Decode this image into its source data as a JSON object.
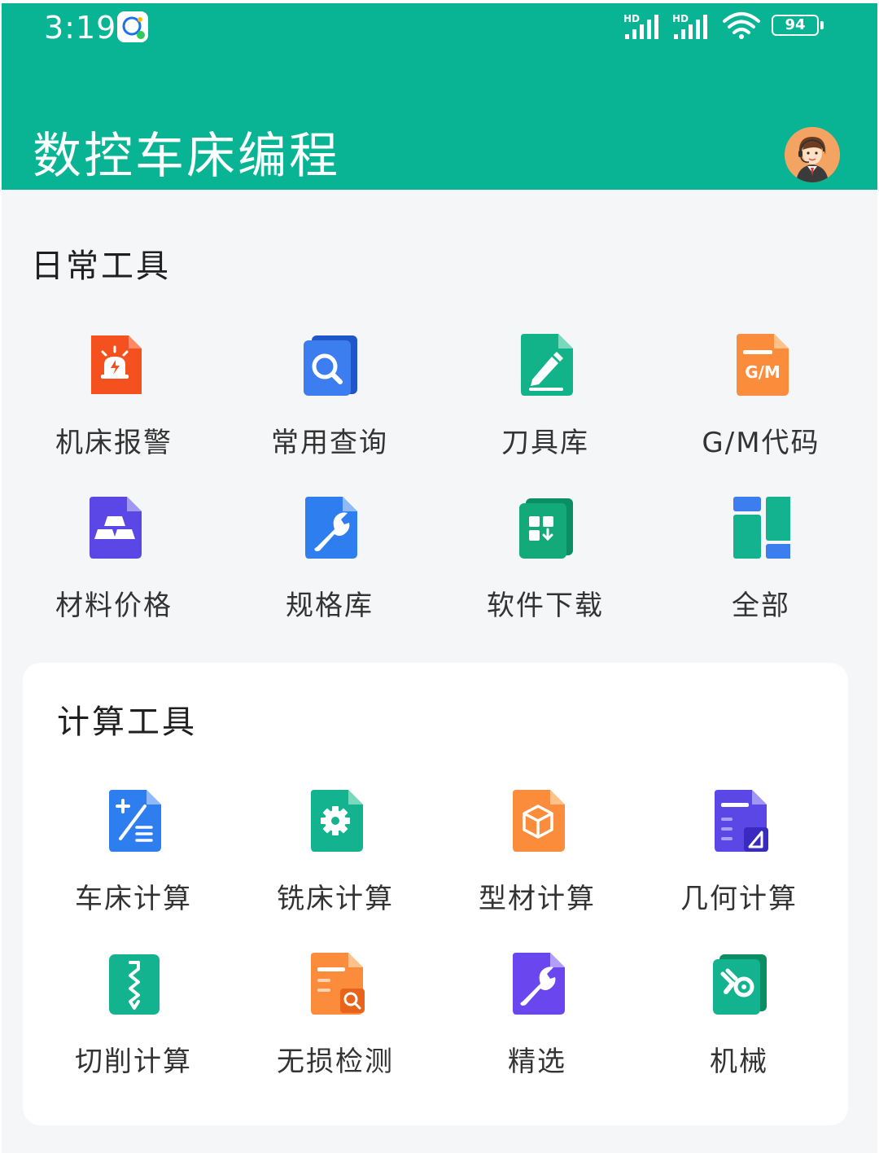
{
  "status_bar": {
    "time": "3:19",
    "network_1": "HD",
    "network_2": "HD",
    "battery": "94",
    "chat_icon": "chat-bubble-icon",
    "wifi_icon": "wifi-icon"
  },
  "header": {
    "title": "数控车床编程",
    "avatar_icon": "support-agent-avatar",
    "background": "#09b495"
  },
  "daily_tools": {
    "title": "日常工具",
    "items": [
      {
        "label": "机床报警",
        "icon": "alarm-icon",
        "color": "#f4511e"
      },
      {
        "label": "常用查询",
        "icon": "search-icon",
        "color": "#2f6fe4"
      },
      {
        "label": "刀具库",
        "icon": "pen-icon",
        "color": "#12b388"
      },
      {
        "label": "G/M代码",
        "icon": "gm-code-icon",
        "color": "#fb8c3c",
        "icon_text": "G/M"
      },
      {
        "label": "材料价格",
        "icon": "gold-bars-icon",
        "color": "#5b47e6"
      },
      {
        "label": "规格库",
        "icon": "wrench-icon",
        "color": "#2f7ef0"
      },
      {
        "label": "软件下载",
        "icon": "download-grid-icon",
        "color": "#14a978"
      },
      {
        "label": "全部",
        "icon": "all-blocks-icon",
        "color": "#14b38f"
      }
    ]
  },
  "calc_tools": {
    "title": "计算工具",
    "items": [
      {
        "label": "车床计算",
        "icon": "calculator-icon",
        "color": "#2f7ef0"
      },
      {
        "label": "铣床计算",
        "icon": "gear-icon",
        "color": "#14b38f"
      },
      {
        "label": "型材计算",
        "icon": "cube-icon",
        "color": "#fb8c3c"
      },
      {
        "label": "几何计算",
        "icon": "geometry-icon",
        "color": "#5b47e6"
      },
      {
        "label": "切削计算",
        "icon": "drill-bit-icon",
        "color": "#14b38f"
      },
      {
        "label": "无损检测",
        "icon": "inspect-document-icon",
        "color": "#fb8c3c"
      },
      {
        "label": "精选",
        "icon": "wrench-icon",
        "color": "#6a46ef"
      },
      {
        "label": "机械",
        "icon": "mechanical-tools-icon",
        "color": "#14b38f"
      }
    ]
  }
}
